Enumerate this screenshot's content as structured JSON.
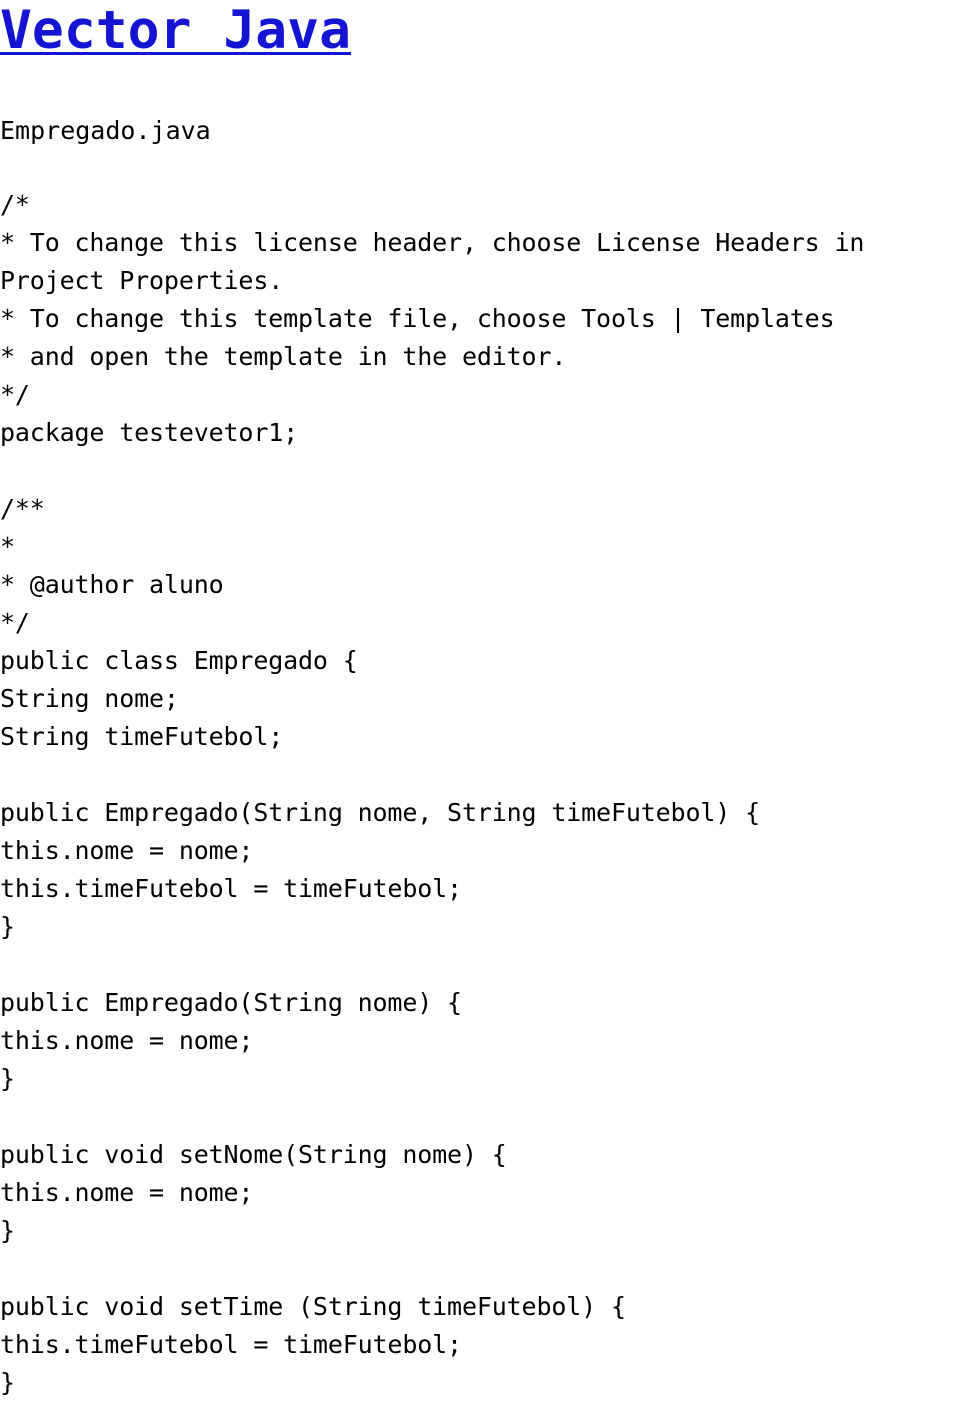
{
  "page": {
    "title": "Vector Java",
    "title_color": "#1414d2",
    "background": "#ffffff",
    "text_color": "#000000"
  },
  "document": {
    "filename": "Empregado.java",
    "language": "java",
    "package": "testevetor1",
    "class_name": "Empregado",
    "author": "aluno"
  },
  "code": {
    "blocks": [
      {
        "id": "license-comment",
        "lines": [
          "/*",
          "* To change this license header, choose License Headers in Project Properties.",
          "* To change this template file, choose Tools | Templates",
          "* and open the template in the editor.",
          "*/",
          "package testevetor1;"
        ]
      },
      {
        "id": "javadoc-and-class",
        "lines": [
          "/**",
          "*",
          "* @author aluno",
          "*/",
          "public class Empregado {",
          "String nome;",
          "String timeFutebol;"
        ]
      },
      {
        "id": "constructor-two-args",
        "lines": [
          "public Empregado(String nome, String timeFutebol) {",
          "this.nome = nome;",
          "this.timeFutebol = timeFutebol;",
          "}"
        ]
      },
      {
        "id": "constructor-one-arg",
        "lines": [
          "public Empregado(String nome) {",
          "this.nome = nome;",
          "}"
        ]
      },
      {
        "id": "method-set-nome",
        "lines": [
          "public void setNome(String nome) {",
          "this.nome = nome;",
          "}"
        ]
      },
      {
        "id": "method-set-time",
        "lines": [
          "public void setTime (String timeFutebol) {",
          "this.timeFutebol = timeFutebol;",
          "}"
        ]
      }
    ]
  }
}
